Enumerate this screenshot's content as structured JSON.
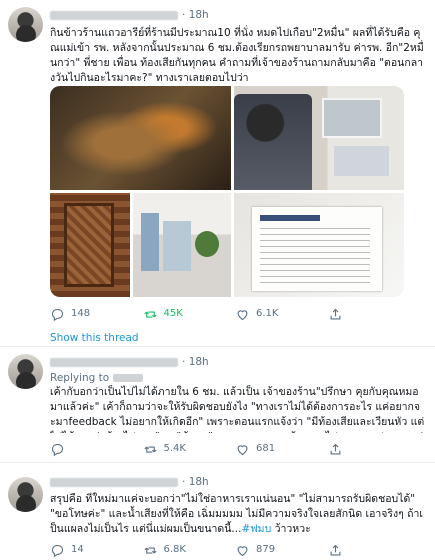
{
  "tweets": [
    {
      "time": "18h",
      "text": "กินข้าวร้านแถวอารีย์ที่ร้านมีประมาณ10 ที่นั่ง หมดไปเกือบ\"2หมื่น\" ผลที่ได้รับคือ คุณแม่เข้า รพ. หลังจากนั้นประมาณ 6 ชม.ต้องเรียกรถพยาบาลมารับ ค่ารพ. อีก\"2หมื่นกว่า\" พี่ชาย เพื่อน ท้องเสียกันทุกคน คำถามที่เจ้าของร้านถามกลับมาคือ \"ตอนกลางวันไปกินอะไรมาคะ?\" ทางเราเลยตอบไปว่า",
      "replies": "148",
      "retweets": "45K",
      "likes": "6.1K"
    },
    {
      "time": "18h",
      "replying_to": "Replying to",
      "text": "เค้ากับอกว่าเป็นไปไม่ได้ภายใน 6 ชม. แล้วเป็น เจ้าของร้าน\"ปรึกษา คุยกับคุณหมอมาแล้วค่ะ\" เค้าก็ถามว่าจะให้รับผิดชอบยังไง \"ทางเราไม่ได้ต้องการอะไร แค่อยากจะมาfeedback ไม่อยากให้เกิดอีก\" เพราะตอนแรกแจ้งว่า \"มีท้องเสียและเวียนหัว แต่ไม่ได้บอกว่าต้องไป รพ.\" ... \"ข้อมูล\" เพราะตอนแรกแจ้งราคาไป จข.บอกประมาณว่า\"ให้เรียนตามตรงคารพ. ทางเราไม่สามารถรับผิดชอบได้ค่ะ\"(3)",
      "replies": "",
      "retweets": "5.4K",
      "likes": "681"
    },
    {
      "time": "18h",
      "text": "สรุปคือ ที่ใหม่มาแค่จะบอกว่า\"ไม่ใช่อาหารเราแน่นอน\" \"ไม่สามารถรับผิดชอบได้\" \"ขอโทษค่ะ\" และน้ำเสียงที่ให้คือ เฉิ่มมมมม ไม่มีความจริงใจเลยสักนิด เอาจริงๆ ถ้าเป็นแผลงไม่เป็นไร แต่นี่แม่ผมเป็นขนาดนี้...",
      "hashtag": "#ฟมบ",
      "tail": " ว้าวหวะ",
      "replies": "14",
      "retweets": "6.8K",
      "likes": "879"
    }
  ],
  "show_thread": "Show this thread",
  "media": [
    {
      "name": "food-plate-image",
      "colors": [
        "#4a3a25",
        "#8b6a3f",
        "#2d2318"
      ]
    },
    {
      "name": "hospital-room-image",
      "colors": [
        "#d8d4cd",
        "#6a6e76",
        "#e9e7e2"
      ]
    },
    {
      "name": "carved-door-image",
      "colors": [
        "#7a4a2a",
        "#a0663a",
        "#5a3216"
      ]
    },
    {
      "name": "hospital-corridor-image",
      "colors": [
        "#e8e6e2",
        "#c9c6c1",
        "#6e8a5a"
      ]
    },
    {
      "name": "hospital-bill-image",
      "colors": [
        "#f2f2f0",
        "#3a4e7a",
        "#cfcfcf"
      ]
    }
  ]
}
